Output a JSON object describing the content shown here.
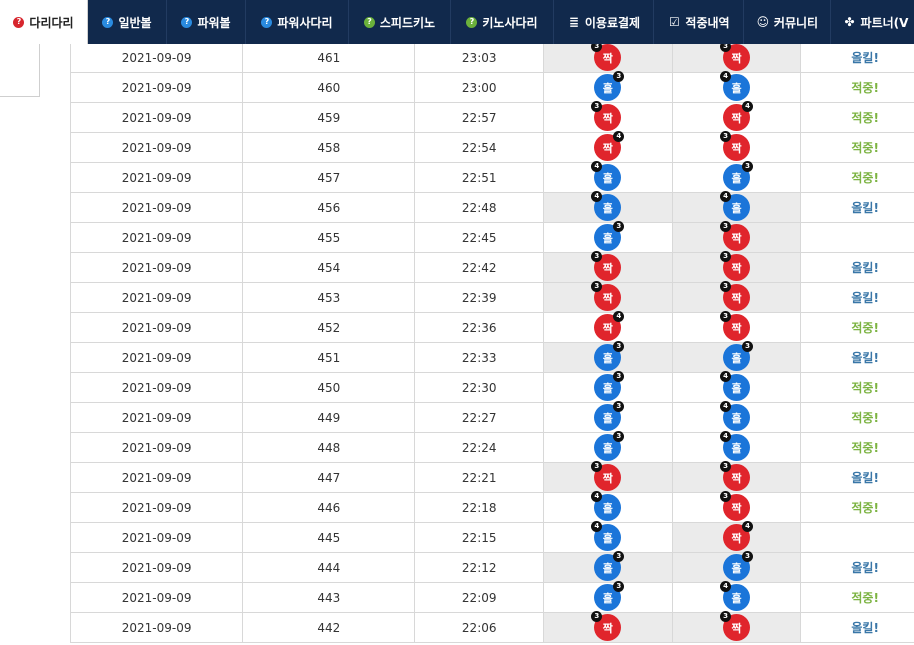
{
  "nav": [
    {
      "label": "다리다리",
      "icon": "question-circle-icon",
      "icon_glyph": "?",
      "color": "red",
      "active": true,
      "width": 88
    },
    {
      "label": "일반볼",
      "icon": "question-circle-icon",
      "icon_glyph": "?",
      "color": "blue",
      "active": false,
      "width": 79
    },
    {
      "label": "파워볼",
      "icon": "question-circle-icon",
      "icon_glyph": "?",
      "color": "blue",
      "active": false,
      "width": 79
    },
    {
      "label": "파워사다리",
      "icon": "question-circle-icon",
      "icon_glyph": "?",
      "color": "blue",
      "active": false,
      "width": 103
    },
    {
      "label": "스피드키노",
      "icon": "question-circle-icon",
      "icon_glyph": "?",
      "color": "green",
      "active": false,
      "width": 102
    },
    {
      "label": "키노사다리",
      "icon": "question-circle-icon",
      "icon_glyph": "?",
      "color": "green",
      "active": false,
      "width": 103
    },
    {
      "label": "이용료결제",
      "icon": "database-icon",
      "icon_glyph": "≣",
      "color": "plain",
      "active": false,
      "width": 100
    },
    {
      "label": "적중내역",
      "icon": "check-square-icon",
      "icon_glyph": "☑",
      "color": "plain",
      "active": false,
      "width": 90
    },
    {
      "label": "커뮤니티",
      "icon": "smile-icon",
      "icon_glyph": "☺",
      "color": "plain",
      "active": false,
      "width": 87
    },
    {
      "label": "파트너(V",
      "icon": "group-icon",
      "icon_glyph": "✤",
      "color": "plain",
      "active": false,
      "width": 90
    }
  ],
  "rows": [
    {
      "date": "2021-09-09",
      "round": "461",
      "time": "23:03",
      "r1": {
        "label": "짝",
        "type": "even",
        "num": "3",
        "pos": "tl"
      },
      "r2": {
        "label": "짝",
        "type": "even",
        "num": "3",
        "pos": "tl"
      },
      "hl": true,
      "verdict": "올킬!",
      "vtype": "no"
    },
    {
      "date": "2021-09-09",
      "round": "460",
      "time": "23:00",
      "r1": {
        "label": "홀",
        "type": "odd",
        "num": "3",
        "pos": "tr"
      },
      "r2": {
        "label": "홀",
        "type": "odd",
        "num": "4",
        "pos": "tl"
      },
      "hl": false,
      "verdict": "적중!",
      "vtype": "ok"
    },
    {
      "date": "2021-09-09",
      "round": "459",
      "time": "22:57",
      "r1": {
        "label": "짝",
        "type": "even",
        "num": "3",
        "pos": "tl"
      },
      "r2": {
        "label": "짝",
        "type": "even",
        "num": "4",
        "pos": "tr"
      },
      "hl": false,
      "verdict": "적중!",
      "vtype": "ok"
    },
    {
      "date": "2021-09-09",
      "round": "458",
      "time": "22:54",
      "r1": {
        "label": "짝",
        "type": "even",
        "num": "4",
        "pos": "tr"
      },
      "r2": {
        "label": "짝",
        "type": "even",
        "num": "3",
        "pos": "tl"
      },
      "hl": false,
      "verdict": "적중!",
      "vtype": "ok"
    },
    {
      "date": "2021-09-09",
      "round": "457",
      "time": "22:51",
      "r1": {
        "label": "홀",
        "type": "odd",
        "num": "4",
        "pos": "tl"
      },
      "r2": {
        "label": "홀",
        "type": "odd",
        "num": "3",
        "pos": "tr"
      },
      "hl": false,
      "verdict": "적중!",
      "vtype": "ok"
    },
    {
      "date": "2021-09-09",
      "round": "456",
      "time": "22:48",
      "r1": {
        "label": "홀",
        "type": "odd",
        "num": "4",
        "pos": "tl"
      },
      "r2": {
        "label": "홀",
        "type": "odd",
        "num": "4",
        "pos": "tl"
      },
      "hl": true,
      "verdict": "올킬!",
      "vtype": "no"
    },
    {
      "date": "2021-09-09",
      "round": "455",
      "time": "22:45",
      "r1": {
        "label": "홀",
        "type": "odd",
        "num": "3",
        "pos": "tr"
      },
      "r2": {
        "label": "짝",
        "type": "even",
        "num": "3",
        "pos": "tl"
      },
      "hl": false,
      "hl2": true,
      "verdict": "",
      "vtype": "no"
    },
    {
      "date": "2021-09-09",
      "round": "454",
      "time": "22:42",
      "r1": {
        "label": "짝",
        "type": "even",
        "num": "3",
        "pos": "tl"
      },
      "r2": {
        "label": "짝",
        "type": "even",
        "num": "3",
        "pos": "tl"
      },
      "hl": true,
      "verdict": "올킬!",
      "vtype": "no"
    },
    {
      "date": "2021-09-09",
      "round": "453",
      "time": "22:39",
      "r1": {
        "label": "짝",
        "type": "even",
        "num": "3",
        "pos": "tl"
      },
      "r2": {
        "label": "짝",
        "type": "even",
        "num": "3",
        "pos": "tl"
      },
      "hl": true,
      "verdict": "올킬!",
      "vtype": "no"
    },
    {
      "date": "2021-09-09",
      "round": "452",
      "time": "22:36",
      "r1": {
        "label": "짝",
        "type": "even",
        "num": "4",
        "pos": "tr"
      },
      "r2": {
        "label": "짝",
        "type": "even",
        "num": "3",
        "pos": "tl"
      },
      "hl": false,
      "verdict": "적중!",
      "vtype": "ok"
    },
    {
      "date": "2021-09-09",
      "round": "451",
      "time": "22:33",
      "r1": {
        "label": "홀",
        "type": "odd",
        "num": "3",
        "pos": "tr"
      },
      "r2": {
        "label": "홀",
        "type": "odd",
        "num": "3",
        "pos": "tr"
      },
      "hl": true,
      "verdict": "올킬!",
      "vtype": "no"
    },
    {
      "date": "2021-09-09",
      "round": "450",
      "time": "22:30",
      "r1": {
        "label": "홀",
        "type": "odd",
        "num": "3",
        "pos": "tr"
      },
      "r2": {
        "label": "홀",
        "type": "odd",
        "num": "4",
        "pos": "tl"
      },
      "hl": false,
      "verdict": "적중!",
      "vtype": "ok"
    },
    {
      "date": "2021-09-09",
      "round": "449",
      "time": "22:27",
      "r1": {
        "label": "홀",
        "type": "odd",
        "num": "3",
        "pos": "tr"
      },
      "r2": {
        "label": "홀",
        "type": "odd",
        "num": "4",
        "pos": "tl"
      },
      "hl": false,
      "verdict": "적중!",
      "vtype": "ok"
    },
    {
      "date": "2021-09-09",
      "round": "448",
      "time": "22:24",
      "r1": {
        "label": "홀",
        "type": "odd",
        "num": "3",
        "pos": "tr"
      },
      "r2": {
        "label": "홀",
        "type": "odd",
        "num": "4",
        "pos": "tl"
      },
      "hl": false,
      "verdict": "적중!",
      "vtype": "ok"
    },
    {
      "date": "2021-09-09",
      "round": "447",
      "time": "22:21",
      "r1": {
        "label": "짝",
        "type": "even",
        "num": "3",
        "pos": "tl"
      },
      "r2": {
        "label": "짝",
        "type": "even",
        "num": "3",
        "pos": "tl"
      },
      "hl": true,
      "verdict": "올킬!",
      "vtype": "no"
    },
    {
      "date": "2021-09-09",
      "round": "446",
      "time": "22:18",
      "r1": {
        "label": "홀",
        "type": "odd",
        "num": "4",
        "pos": "tl"
      },
      "r2": {
        "label": "짝",
        "type": "even",
        "num": "3",
        "pos": "tl"
      },
      "hl": false,
      "verdict": "적중!",
      "vtype": "ok"
    },
    {
      "date": "2021-09-09",
      "round": "445",
      "time": "22:15",
      "r1": {
        "label": "홀",
        "type": "odd",
        "num": "4",
        "pos": "tl"
      },
      "r2": {
        "label": "짝",
        "type": "even",
        "num": "4",
        "pos": "tr"
      },
      "hl": false,
      "hl2": true,
      "verdict": "",
      "vtype": "no"
    },
    {
      "date": "2021-09-09",
      "round": "444",
      "time": "22:12",
      "r1": {
        "label": "홀",
        "type": "odd",
        "num": "3",
        "pos": "tr"
      },
      "r2": {
        "label": "홀",
        "type": "odd",
        "num": "3",
        "pos": "tr"
      },
      "hl": true,
      "verdict": "올킬!",
      "vtype": "no"
    },
    {
      "date": "2021-09-09",
      "round": "443",
      "time": "22:09",
      "r1": {
        "label": "홀",
        "type": "odd",
        "num": "3",
        "pos": "tr"
      },
      "r2": {
        "label": "홀",
        "type": "odd",
        "num": "4",
        "pos": "tl"
      },
      "hl": false,
      "verdict": "적중!",
      "vtype": "ok"
    },
    {
      "date": "2021-09-09",
      "round": "442",
      "time": "22:06",
      "r1": {
        "label": "짝",
        "type": "even",
        "num": "3",
        "pos": "tl"
      },
      "r2": {
        "label": "짝",
        "type": "even",
        "num": "3",
        "pos": "tl"
      },
      "hl": true,
      "verdict": "올킬!",
      "vtype": "no"
    }
  ],
  "colors": {
    "nav_bg": "#11294c",
    "odd_ball": "#1b75d9",
    "even_ball": "#e0252c",
    "hit": "#7cb342",
    "allkill": "#3a77a8",
    "highlight_cell": "#ebebeb"
  }
}
